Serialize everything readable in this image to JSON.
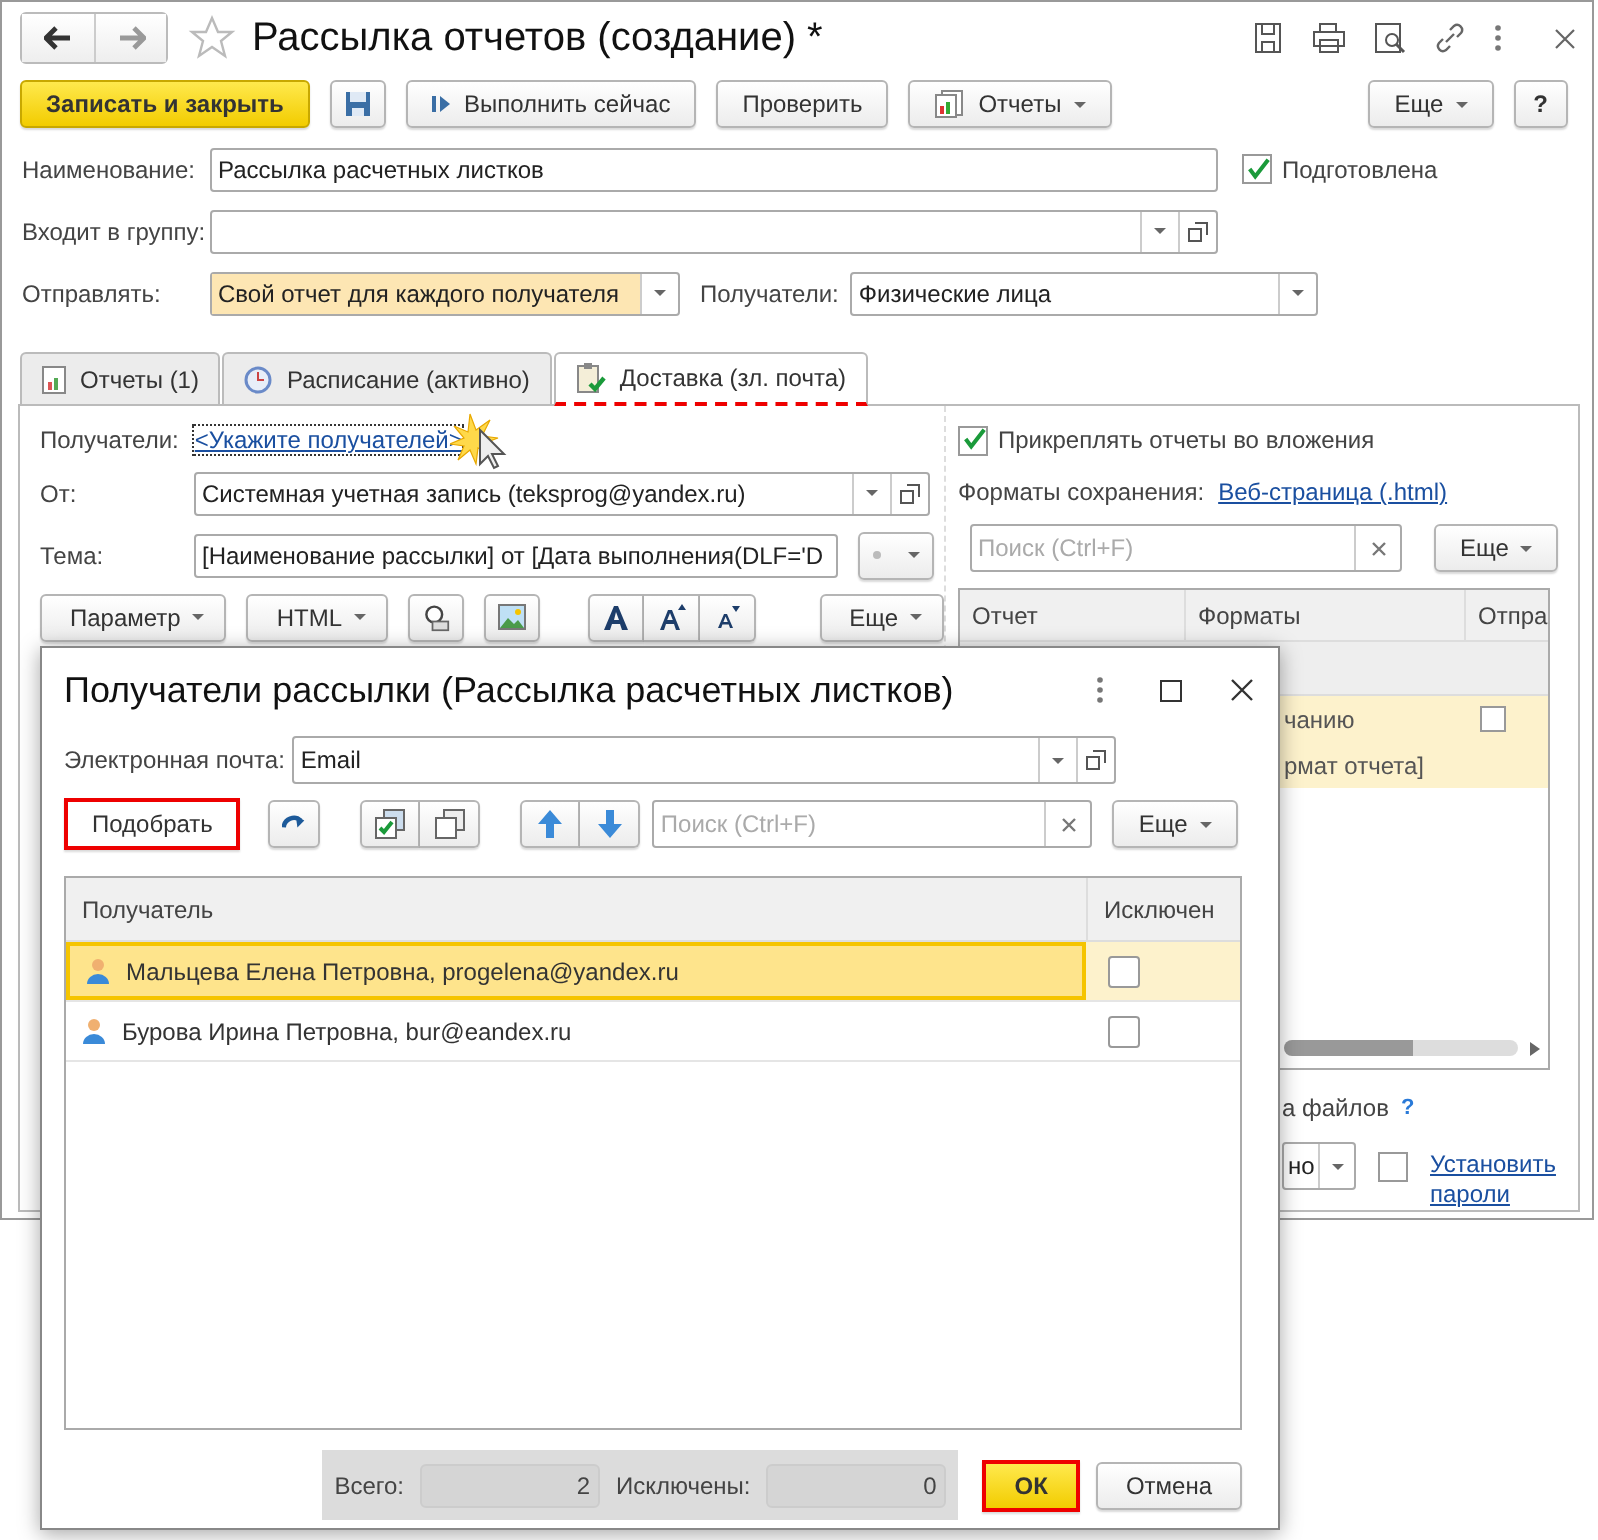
{
  "window": {
    "title": "Рассылка отчетов (создание) *"
  },
  "toolbar": {
    "save_close": "Записать и закрыть",
    "run_now": "Выполнить сейчас",
    "check": "Проверить",
    "reports": "Отчеты",
    "more": "Еще",
    "help": "?"
  },
  "form": {
    "name": {
      "label": "Наименование:",
      "value": "Рассылка расчетных листков"
    },
    "prepared": {
      "label": "Подготовлена",
      "checked": true
    },
    "group": {
      "label": "Входит в группу:"
    },
    "send": {
      "label": "Отправлять:",
      "value": "Свой отчет для каждого получателя"
    },
    "recipients_type": {
      "label": "Получатели:",
      "value": "Физические лица"
    }
  },
  "tabs": [
    {
      "label": "Отчеты (1)",
      "selected": false
    },
    {
      "label": "Расписание (активно)",
      "selected": false
    },
    {
      "label": "Доставка (зл. почта)",
      "selected": true
    }
  ],
  "delivery": {
    "recipients_label": "Получатели:",
    "recipients_link": "<Укажите получателей>",
    "from_label": "От:",
    "from_value": "Системная учетная запись (teksprog@yandex.ru)",
    "subject_label": "Тема:",
    "subject_value": "[Наименование рассылки] от [Дата выполнения(DLF='D",
    "param_button": "Параметр",
    "html_button": "HTML",
    "more": "Еще",
    "attach": {
      "label": "Прикреплять отчеты во вложения",
      "checked": true
    },
    "formats_label": "Форматы сохранения:",
    "formats_link": "Веб-страница (.html)",
    "search_placeholder": "Поиск (Ctrl+F)",
    "search_more": "Еще",
    "table": {
      "columns": [
        "Отчет",
        "Форматы",
        "Отпра"
      ],
      "rows": [
        {
          "kind": "checkbox-row",
          "text": "чанию",
          "checked": false
        },
        {
          "kind": "text-row",
          "text": "рмат отчета]"
        }
      ]
    },
    "naming_label": "а файлов",
    "naming_help": "?",
    "protect_value": "но",
    "password": {
      "checked": false
    },
    "set_passwords_link": "Установить пароли"
  },
  "dialog": {
    "title": "Получатели рассылки (Рассылка расчетных листков)",
    "email_label": "Электронная почта:",
    "email_value": "Email",
    "pick_button": "Подобрать",
    "search_placeholder": "Поиск (Ctrl+F)",
    "more": "Еще",
    "columns": [
      "Получатель",
      "Исключен"
    ],
    "rows": [
      {
        "text": "Мальцева Елена Петровна, progelena@yandex.ru",
        "selected": true,
        "excluded": false
      },
      {
        "text": "Бурова Ирина Петровна, bur@eandex.ru",
        "selected": false,
        "excluded": false
      }
    ],
    "total_label": "Всего:",
    "total": "2",
    "excluded_label": "Исключены:",
    "excluded": "0",
    "ok": "ОК",
    "cancel": "Отмена"
  }
}
